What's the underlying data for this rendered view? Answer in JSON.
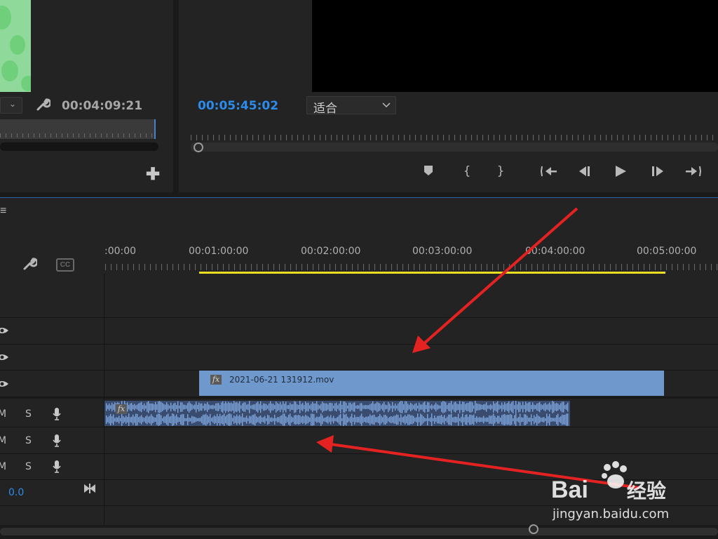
{
  "source_monitor": {
    "timecode": "00:04:09:21"
  },
  "program_monitor": {
    "timecode": "00:05:45:02",
    "fit_dropdown": {
      "value": "适合"
    }
  },
  "timeline": {
    "ruler_labels": [
      ":00:00",
      "00:01:00:00",
      "00:02:00:00",
      "00:03:00:00",
      "00:04:00:00",
      "00:05:00:00"
    ],
    "video_clip_name": "2021-06-21 131912.mov",
    "track_buttons": {
      "mute": "M",
      "solo": "S"
    },
    "master_level": "0.0"
  },
  "watermark": {
    "brand": "Bai",
    "brand_suffix": "经验",
    "url": "jingyan.baidu.com"
  },
  "colors": {
    "accent_blue": "#2d8ceb",
    "video_clip": "#6f98cc",
    "audio_clip": "#394b6e",
    "work_area": "#e8e020",
    "annotation_arrow": "#e52222"
  }
}
